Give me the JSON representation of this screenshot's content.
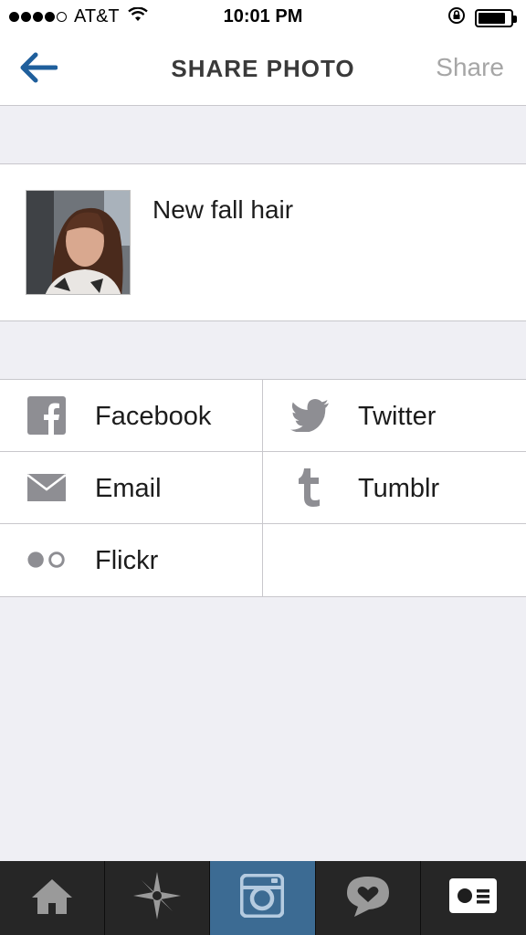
{
  "status_bar": {
    "carrier": "AT&T",
    "time": "10:01 PM",
    "signal_bars": 4,
    "battery_level": 0.85
  },
  "nav": {
    "back_icon": "arrow-left-icon",
    "title": "SHARE PHOTO",
    "share_label": "Share",
    "accent_color": "#1f5f9c"
  },
  "caption": {
    "text": "New fall hair"
  },
  "share_options": {
    "facebook": {
      "label": "Facebook",
      "icon": "facebook-icon"
    },
    "twitter": {
      "label": "Twitter",
      "icon": "twitter-icon"
    },
    "email": {
      "label": "Email",
      "icon": "envelope-icon"
    },
    "tumblr": {
      "label": "Tumblr",
      "icon": "tumblr-icon"
    },
    "flickr": {
      "label": "Flickr",
      "icon": "flickr-icon"
    }
  },
  "tab_bar": {
    "tabs": [
      "home-icon",
      "explore-icon",
      "camera-icon",
      "news-icon",
      "profile-icon"
    ],
    "active_tab": "camera-icon",
    "active_color": "#3c6b93"
  }
}
